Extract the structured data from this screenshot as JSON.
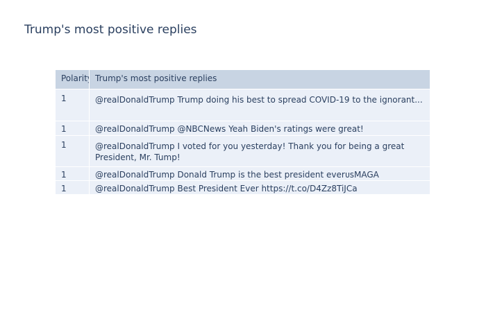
{
  "chart_data": {
    "type": "table",
    "title": "Trump's most positive replies",
    "columns": [
      "Polarity",
      "Trump's most positive replies"
    ],
    "rows": [
      {
        "polarity": "1",
        "reply": "@realDonaldTrump Trump doing his best to spread COVID-19 to the ignorant..."
      },
      {
        "polarity": "1",
        "reply": "@realDonaldTrump @NBCNews Yeah Biden's ratings were great!"
      },
      {
        "polarity": "1",
        "reply": "@realDonaldTrump  I voted for you yesterday! Thank you for being a great President, Mr. Tump!"
      },
      {
        "polarity": "1",
        "reply": "@realDonaldTrump Donald Trump is the best president everᴜsMAGA"
      },
      {
        "polarity": "1",
        "reply": "@realDonaldTrump Best President Ever https://t.co/D4Zz8TiJCa"
      }
    ]
  }
}
